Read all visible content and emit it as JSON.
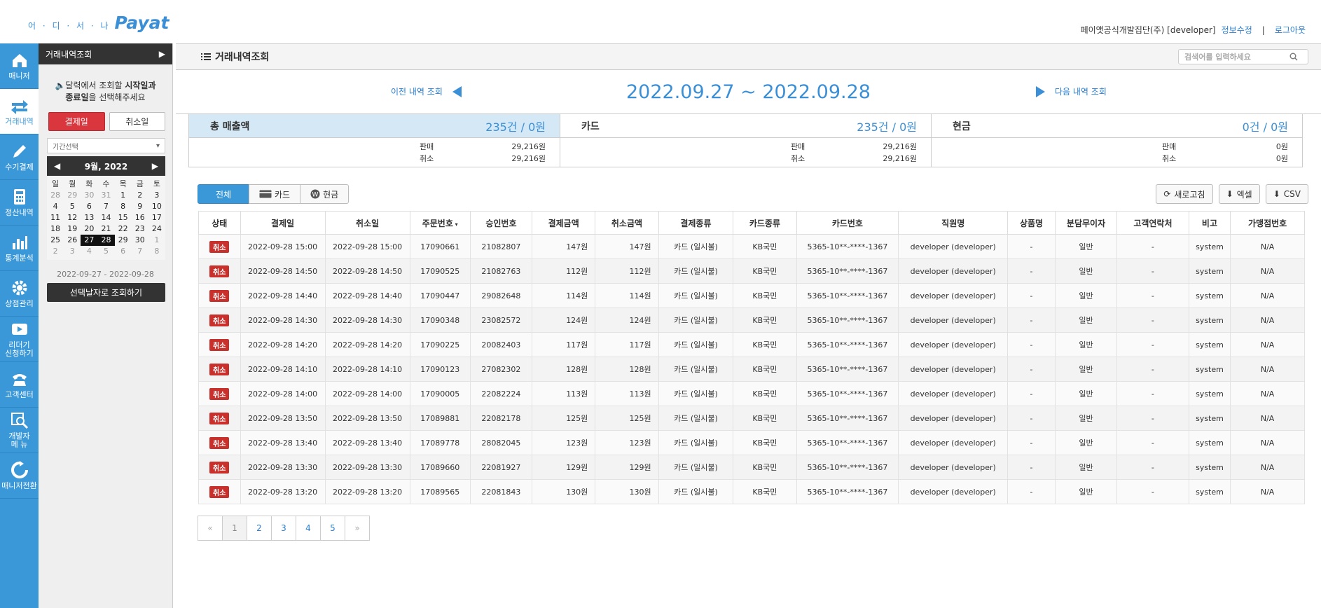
{
  "header": {
    "logo_dots": "어 · 디 · 서 · 나",
    "logo_text": "Payat",
    "user": "페이앳공식개발집단(주) [developer]",
    "edit_info": "정보수정",
    "logout": "로그아웃"
  },
  "nav": [
    {
      "label": "매니저",
      "icon": "home-icon"
    },
    {
      "label": "거래내역",
      "icon": "exchange-icon"
    },
    {
      "label": "수기결제",
      "icon": "pencil-icon"
    },
    {
      "label": "정산내역",
      "icon": "calculator-icon"
    },
    {
      "label": "통계분석",
      "icon": "bar-chart-icon"
    },
    {
      "label": "상점관리",
      "icon": "gear-icon"
    },
    {
      "label": "리더기\n신청하기",
      "icon": "video-icon"
    },
    {
      "label": "고객센터",
      "icon": "phone-icon"
    },
    {
      "label": "개발자\n메 뉴",
      "icon": "dev-search-icon"
    },
    {
      "label": "매니저전환",
      "icon": "refresh-icon"
    }
  ],
  "calendar": {
    "panel_title": "거래내역조회",
    "hint_line1_pre": "달력에서 조회할 ",
    "hint_line1_bold": "시작일과",
    "hint_line2_bold": "종료일",
    "hint_line2_post": "을 선택해주세요",
    "btn_pay_date": "결제일",
    "btn_cancel_date": "취소일",
    "period_placeholder": "기간선택",
    "month_label": "9월, 2022",
    "dow": [
      "일",
      "월",
      "화",
      "수",
      "목",
      "금",
      "토"
    ],
    "days": [
      {
        "d": "28",
        "m": true
      },
      {
        "d": "29",
        "m": true
      },
      {
        "d": "30",
        "m": true
      },
      {
        "d": "31",
        "m": true
      },
      {
        "d": "1"
      },
      {
        "d": "2"
      },
      {
        "d": "3"
      },
      {
        "d": "4"
      },
      {
        "d": "5"
      },
      {
        "d": "6"
      },
      {
        "d": "7"
      },
      {
        "d": "8"
      },
      {
        "d": "9"
      },
      {
        "d": "10"
      },
      {
        "d": "11"
      },
      {
        "d": "12"
      },
      {
        "d": "13"
      },
      {
        "d": "14"
      },
      {
        "d": "15"
      },
      {
        "d": "16"
      },
      {
        "d": "17"
      },
      {
        "d": "18"
      },
      {
        "d": "19"
      },
      {
        "d": "20"
      },
      {
        "d": "21"
      },
      {
        "d": "22"
      },
      {
        "d": "23"
      },
      {
        "d": "24"
      },
      {
        "d": "25"
      },
      {
        "d": "26"
      },
      {
        "d": "27",
        "s": true
      },
      {
        "d": "28",
        "s": true
      },
      {
        "d": "29"
      },
      {
        "d": "30"
      },
      {
        "d": "1",
        "m": true
      },
      {
        "d": "2",
        "m": true
      },
      {
        "d": "3",
        "m": true
      },
      {
        "d": "4",
        "m": true
      },
      {
        "d": "5",
        "m": true
      },
      {
        "d": "6",
        "m": true
      },
      {
        "d": "7",
        "m": true
      },
      {
        "d": "8",
        "m": true
      }
    ],
    "range_text": "2022-09-27 - 2022-09-28",
    "submit": "선택날자로 조회하기"
  },
  "main": {
    "title": "거래내역조회",
    "search_placeholder": "검색어를 입력하세요",
    "prev": "이전 내역 조회",
    "next": "다음 내역 조회",
    "range": "2022.09.27 ~ 2022.09.28"
  },
  "summary": [
    {
      "title": "총 매출액",
      "value": "235건 / 0원",
      "sale_label": "판매",
      "sale": "29,216원",
      "cancel_label": "취소",
      "cancel": "29,216원"
    },
    {
      "title": "카드",
      "value": "235건 / 0원",
      "sale_label": "판매",
      "sale": "29,216원",
      "cancel_label": "취소",
      "cancel": "29,216원"
    },
    {
      "title": "현금",
      "value": "0건 / 0원",
      "sale_label": "판매",
      "sale": "0원",
      "cancel_label": "취소",
      "cancel": "0원"
    }
  ],
  "filters": {
    "all": "전체",
    "card": "카드",
    "cash": "현금",
    "refresh": "새로고침",
    "excel": "엑셀",
    "csv": "CSV"
  },
  "table": {
    "headers": [
      "상태",
      "결제일",
      "취소일",
      "주문번호",
      "승인번호",
      "결제금액",
      "취소금액",
      "결제종류",
      "카드종류",
      "카드번호",
      "직원명",
      "상품명",
      "분담무이자",
      "고객연락처",
      "비고",
      "가맹점번호"
    ],
    "rows": [
      [
        "취소",
        "2022-09-28 15:00",
        "2022-09-28 15:00",
        "17090661",
        "21082807",
        "147원",
        "147원",
        "카드 (일시불)",
        "KB국민",
        "5365-10**-****-1367",
        "developer (developer)",
        "-",
        "일반",
        "-",
        "system",
        "N/A"
      ],
      [
        "취소",
        "2022-09-28 14:50",
        "2022-09-28 14:50",
        "17090525",
        "21082763",
        "112원",
        "112원",
        "카드 (일시불)",
        "KB국민",
        "5365-10**-****-1367",
        "developer (developer)",
        "-",
        "일반",
        "-",
        "system",
        "N/A"
      ],
      [
        "취소",
        "2022-09-28 14:40",
        "2022-09-28 14:40",
        "17090447",
        "29082648",
        "114원",
        "114원",
        "카드 (일시불)",
        "KB국민",
        "5365-10**-****-1367",
        "developer (developer)",
        "-",
        "일반",
        "-",
        "system",
        "N/A"
      ],
      [
        "취소",
        "2022-09-28 14:30",
        "2022-09-28 14:30",
        "17090348",
        "23082572",
        "124원",
        "124원",
        "카드 (일시불)",
        "KB국민",
        "5365-10**-****-1367",
        "developer (developer)",
        "-",
        "일반",
        "-",
        "system",
        "N/A"
      ],
      [
        "취소",
        "2022-09-28 14:20",
        "2022-09-28 14:20",
        "17090225",
        "20082403",
        "117원",
        "117원",
        "카드 (일시불)",
        "KB국민",
        "5365-10**-****-1367",
        "developer (developer)",
        "-",
        "일반",
        "-",
        "system",
        "N/A"
      ],
      [
        "취소",
        "2022-09-28 14:10",
        "2022-09-28 14:10",
        "17090123",
        "27082302",
        "128원",
        "128원",
        "카드 (일시불)",
        "KB국민",
        "5365-10**-****-1367",
        "developer (developer)",
        "-",
        "일반",
        "-",
        "system",
        "N/A"
      ],
      [
        "취소",
        "2022-09-28 14:00",
        "2022-09-28 14:00",
        "17090005",
        "22082224",
        "113원",
        "113원",
        "카드 (일시불)",
        "KB국민",
        "5365-10**-****-1367",
        "developer (developer)",
        "-",
        "일반",
        "-",
        "system",
        "N/A"
      ],
      [
        "취소",
        "2022-09-28 13:50",
        "2022-09-28 13:50",
        "17089881",
        "22082178",
        "125원",
        "125원",
        "카드 (일시불)",
        "KB국민",
        "5365-10**-****-1367",
        "developer (developer)",
        "-",
        "일반",
        "-",
        "system",
        "N/A"
      ],
      [
        "취소",
        "2022-09-28 13:40",
        "2022-09-28 13:40",
        "17089778",
        "28082045",
        "123원",
        "123원",
        "카드 (일시불)",
        "KB국민",
        "5365-10**-****-1367",
        "developer (developer)",
        "-",
        "일반",
        "-",
        "system",
        "N/A"
      ],
      [
        "취소",
        "2022-09-28 13:30",
        "2022-09-28 13:30",
        "17089660",
        "22081927",
        "129원",
        "129원",
        "카드 (일시불)",
        "KB국민",
        "5365-10**-****-1367",
        "developer (developer)",
        "-",
        "일반",
        "-",
        "system",
        "N/A"
      ],
      [
        "취소",
        "2022-09-28 13:20",
        "2022-09-28 13:20",
        "17089565",
        "22081843",
        "130원",
        "130원",
        "카드 (일시불)",
        "KB국민",
        "5365-10**-****-1367",
        "developer (developer)",
        "-",
        "일반",
        "-",
        "system",
        "N/A"
      ]
    ]
  },
  "pager": [
    "«",
    "1",
    "2",
    "3",
    "4",
    "5",
    "»"
  ]
}
